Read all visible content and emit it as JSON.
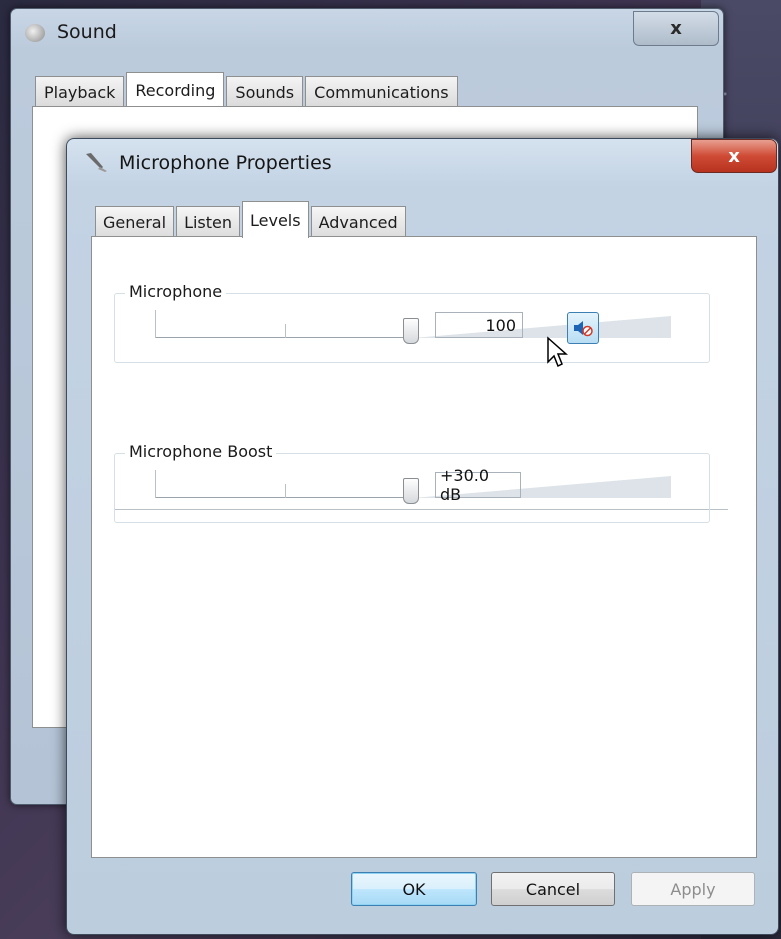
{
  "sound_window": {
    "title": "Sound",
    "close_label": "x",
    "tabs": [
      {
        "label": "Playback"
      },
      {
        "label": "Recording"
      },
      {
        "label": "Sounds"
      },
      {
        "label": "Communications"
      }
    ],
    "active_tab": "Recording"
  },
  "mic_window": {
    "title": "Microphone Properties",
    "close_label": "x",
    "tabs": [
      {
        "label": "General"
      },
      {
        "label": "Listen"
      },
      {
        "label": "Levels"
      },
      {
        "label": "Advanced"
      }
    ],
    "active_tab": "Levels",
    "microphone": {
      "label": "Microphone",
      "value": "100",
      "level_fraction": 1.0
    },
    "boost": {
      "label": "Microphone Boost",
      "value": "+30.0 dB",
      "level_fraction": 1.0
    },
    "buttons": {
      "ok": "OK",
      "cancel": "Cancel",
      "apply": "Apply"
    }
  },
  "colors": {
    "accent": "#3c7fb1",
    "mute_icon": "#1e64b4",
    "close_red": "#cf4b35"
  }
}
